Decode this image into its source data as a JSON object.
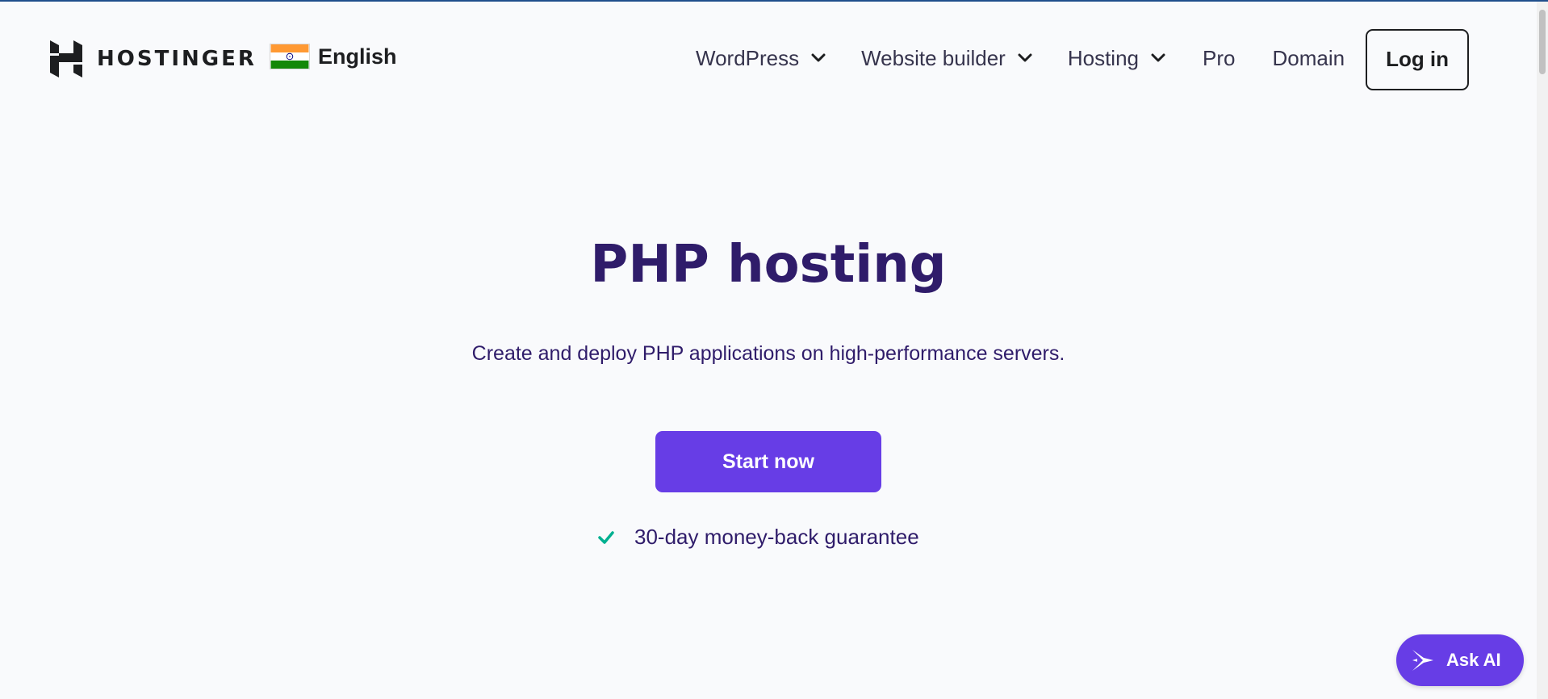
{
  "header": {
    "brand": "HOSTINGER",
    "language": "English",
    "nav": {
      "wordpress": "WordPress",
      "website_builder": "Website builder",
      "hosting": "Hosting",
      "pro": "Pro",
      "domain": "Domain"
    },
    "login_label": "Log in"
  },
  "hero": {
    "title": "PHP hosting",
    "subtitle": "Create and deploy PHP applications on high-performance servers.",
    "cta_label": "Start now",
    "guarantee": "30-day money-back guarantee"
  },
  "assistant": {
    "label": "Ask AI"
  },
  "icons": {
    "logo": "hostinger-logo-icon",
    "flag": "india-flag-icon",
    "dropdown": "chevron-down-icon",
    "check": "check-icon",
    "assistant": "ai-sparkle-icon"
  },
  "colors": {
    "accent": "#673de6",
    "heading": "#2f1c6a",
    "text_dark": "#1d1e20",
    "check": "#00b090",
    "background": "#f9fafc"
  }
}
